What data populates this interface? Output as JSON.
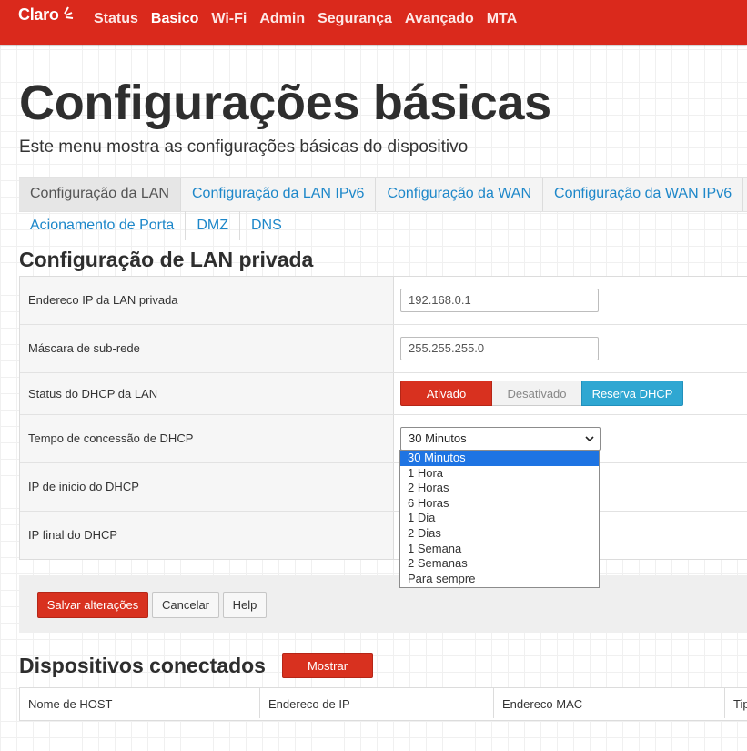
{
  "brand": {
    "logo_text": "Claro",
    "accent_color": "#da291c",
    "link_color": "#1d87c9"
  },
  "nav": {
    "items": [
      {
        "label": "Status"
      },
      {
        "label": "Basico"
      },
      {
        "label": "Wi-Fi"
      },
      {
        "label": "Admin"
      },
      {
        "label": "Segurança"
      },
      {
        "label": "Avançado"
      },
      {
        "label": "MTA"
      }
    ],
    "active": "Basico"
  },
  "page": {
    "title": "Configurações básicas",
    "subtitle": "Este menu mostra as configurações básicas do dispositivo"
  },
  "tabs": {
    "row1": [
      {
        "label": "Configuração da LAN"
      },
      {
        "label": "Configuração da LAN IPv6"
      },
      {
        "label": "Configuração da WAN"
      },
      {
        "label": "Configuração da WAN IPv6"
      }
    ],
    "row2": [
      {
        "label": "Acionamento de Porta"
      },
      {
        "label": "DMZ"
      },
      {
        "label": "DNS"
      }
    ],
    "active": "Configuração da LAN"
  },
  "lan": {
    "section_title": "Configuração de LAN privada",
    "ip_label": "Endereco IP da LAN privada",
    "ip_value": "192.168.0.1",
    "mask_label": "Máscara de sub-rede",
    "mask_value": "255.255.255.0",
    "dhcp_status_label": "Status do DHCP da LAN",
    "dhcp_options": {
      "on": "Ativado",
      "off": "Desativado",
      "reserve": "Reserva DHCP"
    },
    "dhcp_selected": "Ativado",
    "lease_label": "Tempo de concessão de DHCP",
    "lease_value": "30 Minutos",
    "lease_options": [
      "30 Minutos",
      "1 Hora",
      "2 Horas",
      "6 Horas",
      "1 Dia",
      "2 Dias",
      "1 Semana",
      "2 Semanas",
      "Para sempre"
    ],
    "dhcp_start_label": "IP de inicio do DHCP",
    "dhcp_end_label": "IP final do DHCP"
  },
  "buttons": {
    "save": "Salvar alterações",
    "cancel": "Cancelar",
    "help": "Help"
  },
  "devices": {
    "title": "Dispositivos conectados",
    "show_button": "Mostrar",
    "columns": [
      "Nome de HOST",
      "Endereco de IP",
      "Endereco MAC",
      "Tip"
    ]
  },
  "icons": {
    "dropdown": "chevron-down-icon",
    "logo": "claro-logo-icon"
  }
}
